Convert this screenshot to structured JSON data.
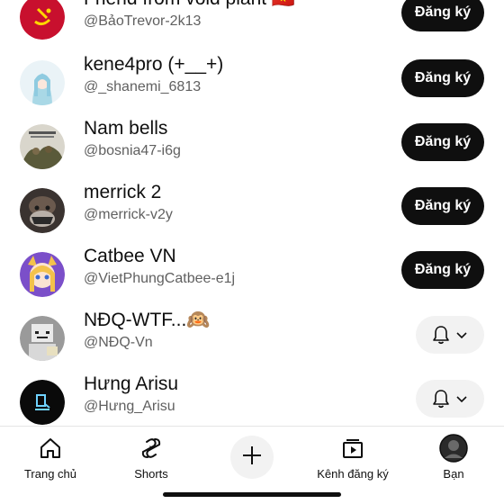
{
  "channels": [
    {
      "name": "Friend from void plant 🇻🇳",
      "handle": "@BảoTrevor-2k13",
      "action": "subscribe",
      "button_label": "Đăng ký"
    },
    {
      "name": "kene4pro (+__+)",
      "handle": "@_shanemi_6813",
      "action": "subscribe",
      "button_label": "Đăng ký"
    },
    {
      "name": "Nam bells",
      "handle": "@bosnia47-i6g",
      "action": "subscribe",
      "button_label": "Đăng ký"
    },
    {
      "name": "merrick 2",
      "handle": "@merrick-v2y",
      "action": "subscribe",
      "button_label": "Đăng ký"
    },
    {
      "name": "Catbee VN",
      "handle": "@VietPhungCatbee-e1j",
      "action": "subscribe",
      "button_label": "Đăng ký"
    },
    {
      "name": "NĐQ-WTF...🙉",
      "handle": "@NĐQ-Vn",
      "action": "subscribed",
      "button_icon": "bell-icon"
    },
    {
      "name": "Hưng Arisu",
      "handle": "@Hưng_Arisu",
      "action": "subscribed",
      "button_icon": "bell-icon"
    }
  ],
  "nav": {
    "home": "Trang chủ",
    "shorts": "Shorts",
    "create_icon": "plus-icon",
    "subscriptions": "Kênh đăng ký",
    "you": "Bạn"
  },
  "colors": {
    "subscribe_button": "#0f0f0f",
    "subscribed_button": "#f2f2f2",
    "text_primary": "#0f0f0f",
    "text_secondary": "#606060"
  }
}
